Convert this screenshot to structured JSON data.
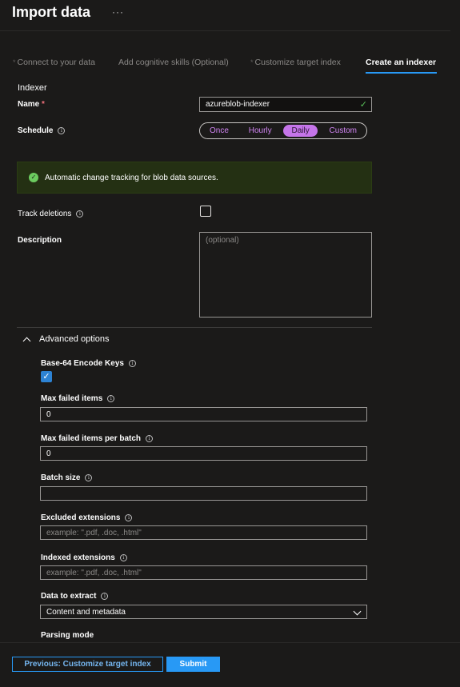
{
  "header": {
    "title": "Import data",
    "more": "···"
  },
  "tabs": [
    {
      "label": "Connect to your data",
      "prefix": "*"
    },
    {
      "label": "Add cognitive skills (Optional)",
      "prefix": ""
    },
    {
      "label": "Customize target index",
      "prefix": "*"
    },
    {
      "label": "Create an indexer",
      "prefix": ""
    }
  ],
  "indexer": {
    "section": "Indexer",
    "name_label": "Name",
    "required": "*",
    "name_value": "azureblob-indexer",
    "schedule_label": "Schedule",
    "schedule_options": [
      "Once",
      "Hourly",
      "Daily",
      "Custom"
    ],
    "schedule_selected": "Daily"
  },
  "banner": {
    "text": "Automatic change tracking for blob data sources."
  },
  "track_deletions": {
    "label": "Track deletions",
    "checked": false
  },
  "description": {
    "label": "Description",
    "placeholder": "(optional)"
  },
  "advanced": {
    "title": "Advanced options",
    "base64": {
      "label": "Base-64 Encode Keys",
      "checked": true
    },
    "max_failed": {
      "label": "Max failed items",
      "value": "0"
    },
    "max_failed_batch": {
      "label": "Max failed items per batch",
      "value": "0"
    },
    "batch_size": {
      "label": "Batch size",
      "value": ""
    },
    "excluded": {
      "label": "Excluded extensions",
      "placeholder": "example: \".pdf, .doc, .html\""
    },
    "indexed": {
      "label": "Indexed extensions",
      "placeholder": "example: \".pdf, .doc, .html\""
    },
    "data_extract": {
      "label": "Data to extract",
      "value": "Content and metadata"
    },
    "parsing_mode": {
      "label": "Parsing mode"
    }
  },
  "footer": {
    "prev_label": "Previous: Customize target index",
    "submit_label": "Submit"
  },
  "colors": {
    "accent": "#2899f5",
    "schedule_accent": "#c575e9",
    "success_bg": "#243013"
  }
}
